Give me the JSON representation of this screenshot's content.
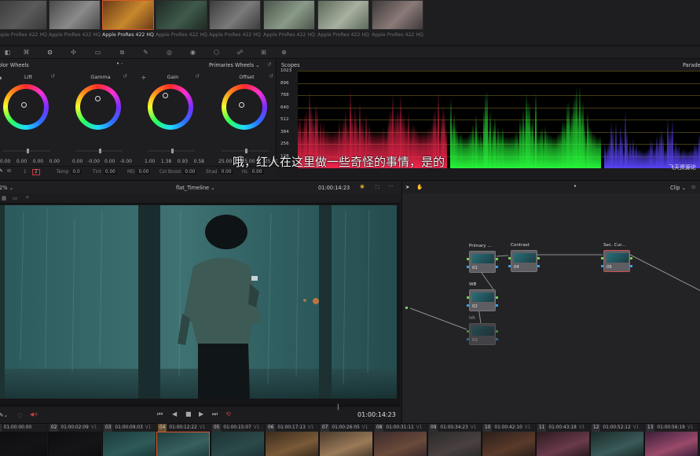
{
  "thumbnails": [
    {
      "label": "Apple ProRes 422 HQ",
      "active": false,
      "colors": [
        "#3a3a3a",
        "#5a5a5a"
      ]
    },
    {
      "label": "Apple ProRes 422 HQ",
      "active": false,
      "colors": [
        "#4a4a4a",
        "#8a8a8a"
      ]
    },
    {
      "label": "Apple ProRes 422 HQ",
      "active": true,
      "colors": [
        "#6a3a18",
        "#c8882c"
      ]
    },
    {
      "label": "Apple ProRes 422 HQ",
      "active": false,
      "colors": [
        "#1e2a24",
        "#3f5a4a"
      ]
    },
    {
      "label": "Apple ProRes 422 HQ",
      "active": false,
      "colors": [
        "#3c3c3c",
        "#7a7a7a"
      ]
    },
    {
      "label": "Apple ProRes 422 HQ",
      "active": false,
      "colors": [
        "#4b554b",
        "#8a9a88"
      ]
    },
    {
      "label": "Apple ProRes 422 HQ",
      "active": false,
      "colors": [
        "#5a6a5a",
        "#a8b0a0"
      ]
    },
    {
      "label": "Apple ProRes 422 HQ",
      "active": false,
      "colors": [
        "#3e3a3a",
        "#8a7a78"
      ]
    }
  ],
  "color_wheels": {
    "title": "olor Wheels",
    "mode": "Primaries Wheels",
    "wheels": [
      {
        "label": "Lift",
        "values": [
          "0.00",
          "0.00",
          "0.00",
          "0.00"
        ],
        "channels": [
          "Y",
          "R",
          "G",
          "B"
        ]
      },
      {
        "label": "Gamma",
        "values": [
          "0.00",
          "-0.00",
          "0.00",
          "-0.00"
        ],
        "channels": [
          "Y",
          "R",
          "G",
          "B"
        ]
      },
      {
        "label": "Gain",
        "values": [
          "1.00",
          "1.38",
          "0.93",
          "0.58"
        ],
        "channels": [
          "Y",
          "R",
          "G",
          "B"
        ]
      },
      {
        "label": "Offset",
        "values": [
          "25.00",
          "25.00",
          "25.00"
        ],
        "channels": [
          "R",
          "G",
          "B"
        ]
      }
    ]
  },
  "params": {
    "page_a": "1",
    "page_b": "2",
    "temp_label": "Temp",
    "temp_value": "0.0",
    "tint_label": "Tint",
    "tint_value": "0.00",
    "md_label": "MD",
    "md_value": "0.00",
    "colboost_label": "Col Boost",
    "colboost_value": "0.00",
    "shad_label": "Shad",
    "shad_value": "0.00",
    "hl_label": "HL",
    "hl_value": "0.00"
  },
  "scopes": {
    "title": "Scopes",
    "mode": "Parade",
    "ticks": [
      "1023",
      "896",
      "768",
      "640",
      "512",
      "384",
      "256",
      "128"
    ]
  },
  "subtitle": "哦，红人在这里做一些奇怪的事情，是的",
  "watermark": "飞天资源论",
  "viewer": {
    "zoom": "2%",
    "timeline_name": "flat_Timeline",
    "timecode": "01:00:14:23",
    "transport_timecode": "01:00:14:23"
  },
  "node_editor": {
    "mode": "Clip",
    "nodes": [
      {
        "label": "Primary ...",
        "id": "01"
      },
      {
        "label": "Contrast",
        "id": "04"
      },
      {
        "label": "Sec. Cur...",
        "id": "05"
      },
      {
        "label": "WB",
        "id": "02"
      },
      {
        "label": "NR",
        "id": "03"
      }
    ]
  },
  "timeline_clips": [
    {
      "num": "1",
      "tc": "01:00:00:00",
      "track": "",
      "colors": [
        "#0d0d0f",
        "#141416"
      ]
    },
    {
      "num": "02",
      "tc": "01:00:02:09",
      "track": "V1",
      "colors": [
        "#0d0d0f",
        "#151517"
      ]
    },
    {
      "num": "03",
      "tc": "01:00:09:03",
      "track": "V1",
      "colors": [
        "#1c3a3c",
        "#2d5a58"
      ]
    },
    {
      "num": "04",
      "tc": "01:00:12:22",
      "track": "V1",
      "colors": [
        "#1e3c3e",
        "#37605e"
      ],
      "active": true
    },
    {
      "num": "05",
      "tc": "01:00:15:07",
      "track": "V1",
      "colors": [
        "#1d3234",
        "#2c4a4a"
      ]
    },
    {
      "num": "06",
      "tc": "01:00:17:13",
      "track": "V1",
      "colors": [
        "#3a2a1c",
        "#7a5a38"
      ]
    },
    {
      "num": "07",
      "tc": "01:00:26:05",
      "track": "V1",
      "colors": [
        "#4a3a2c",
        "#9a7a58"
      ]
    },
    {
      "num": "08",
      "tc": "01:00:31:11",
      "track": "V1",
      "colors": [
        "#3a2a2a",
        "#6a4a3a"
      ]
    },
    {
      "num": "09",
      "tc": "01:00:34:23",
      "track": "V1",
      "colors": [
        "#2a2a2a",
        "#4a4040"
      ]
    },
    {
      "num": "10",
      "tc": "01:00:42:10",
      "track": "V1",
      "colors": [
        "#2a1e1a",
        "#5a3a2a"
      ]
    },
    {
      "num": "11",
      "tc": "01:00:43:18",
      "track": "V1",
      "colors": [
        "#2a1a1e",
        "#6a3a4a"
      ]
    },
    {
      "num": "12",
      "tc": "01:00:52:12",
      "track": "V1",
      "colors": [
        "#1a2a2a",
        "#3a5a58"
      ]
    },
    {
      "num": "13",
      "tc": "01:00:56:19",
      "track": "V1",
      "colors": [
        "#3a1e3a",
        "#9a4a6a"
      ]
    }
  ],
  "accent": "#d85a28"
}
